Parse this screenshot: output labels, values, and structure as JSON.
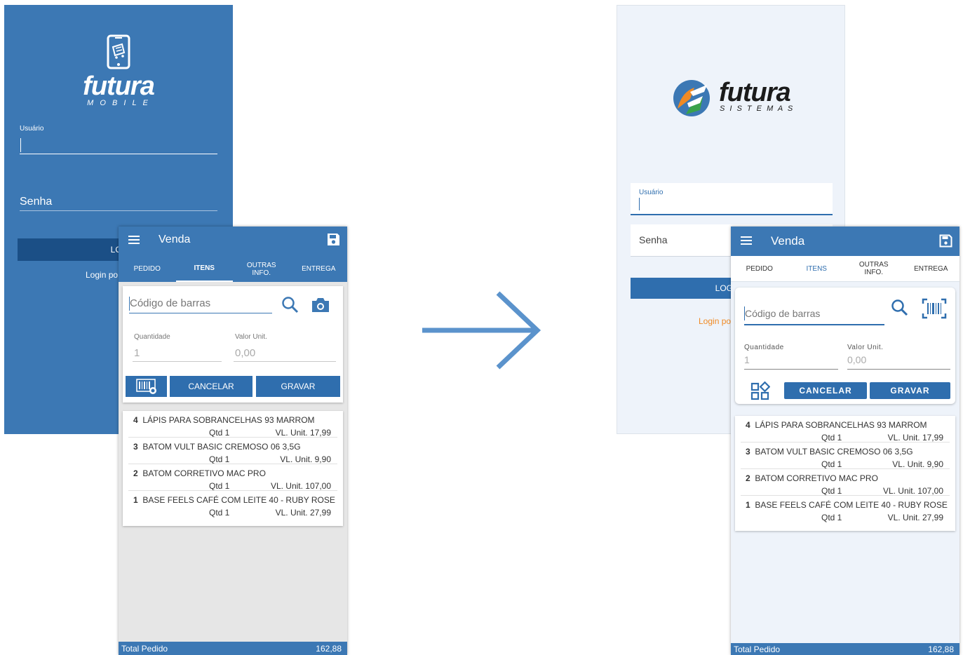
{
  "old": {
    "login": {
      "logo_word": "futura",
      "logo_sub": "M O B I L E",
      "usuario_label": "Usuário",
      "senha_label": "Senha",
      "login_button": "LOG",
      "login_link": "Login po"
    },
    "app": {
      "title": "Venda",
      "tabs": [
        "PEDIDO",
        "ITENS",
        "OUTRAS\nINFO.",
        "ENTREGA"
      ],
      "barcode_placeholder": "Código de barras",
      "quantidade_label": "Quantidade",
      "quantidade_value": "1",
      "valor_label": "Valor Unit.",
      "valor_value": "0,00",
      "cancel_label": "CANCELAR",
      "save_label": "GRAVAR",
      "items": [
        {
          "num": "4",
          "desc": "LÁPIS PARA SOBRANCELHAS 93 MARROM",
          "qty": "Qtd 1",
          "vl": "VL. Unit. 17,99"
        },
        {
          "num": "3",
          "desc": "BATOM VULT BASIC CREMOSO 06 3,5G",
          "qty": "Qtd 1",
          "vl": "VL. Unit. 9,90"
        },
        {
          "num": "2",
          "desc": "BATOM CORRETIVO MAC PRO",
          "qty": "Qtd 1",
          "vl": "VL. Unit. 107,00"
        },
        {
          "num": "1",
          "desc": "BASE FEELS CAFÉ COM LEITE 40 - RUBY ROSE",
          "qty": "Qtd 1",
          "vl": "VL. Unit. 27,99"
        }
      ],
      "total_label": "Total Pedido",
      "total_value": "162,88"
    }
  },
  "new": {
    "login": {
      "logo_word": "futura",
      "logo_sub": "S I S T E M A S",
      "usuario_label": "Usuário",
      "senha_label": "Senha",
      "login_button": "LOG",
      "login_link": "Login po"
    },
    "app": {
      "title": "Venda",
      "tabs": [
        "PEDIDO",
        "ITENS",
        "OUTRAS\nINFO.",
        "ENTREGA"
      ],
      "barcode_placeholder": "Código de barras",
      "quantidade_label": "Quantidade",
      "quantidade_value": "1",
      "valor_label": "Valor Unit.",
      "valor_value": "0,00",
      "cancel_label": "CANCELAR",
      "save_label": "GRAVAR",
      "items": [
        {
          "num": "4",
          "desc": "LÁPIS PARA SOBRANCELHAS 93 MARROM",
          "qty": "Qtd 1",
          "vl": "VL. Unit. 17,99"
        },
        {
          "num": "3",
          "desc": "BATOM VULT BASIC CREMOSO 06 3,5G",
          "qty": "Qtd 1",
          "vl": "VL. Unit. 9,90"
        },
        {
          "num": "2",
          "desc": "BATOM CORRETIVO MAC PRO",
          "qty": "Qtd 1",
          "vl": "VL. Unit. 107,00"
        },
        {
          "num": "1",
          "desc": "BASE FEELS CAFÉ COM LEITE 40 - RUBY ROSE",
          "qty": "Qtd 1",
          "vl": "VL. Unit. 27,99"
        }
      ],
      "total_label": "Total Pedido",
      "total_value": "162,88"
    }
  },
  "colors": {
    "primary_blue": "#3c78b4",
    "dark_blue": "#1b4f86",
    "button_blue": "#2f6eae",
    "arrow_blue": "#5b93cc",
    "logo_orange": "#f08a24",
    "logo_green": "#3aa24a"
  }
}
